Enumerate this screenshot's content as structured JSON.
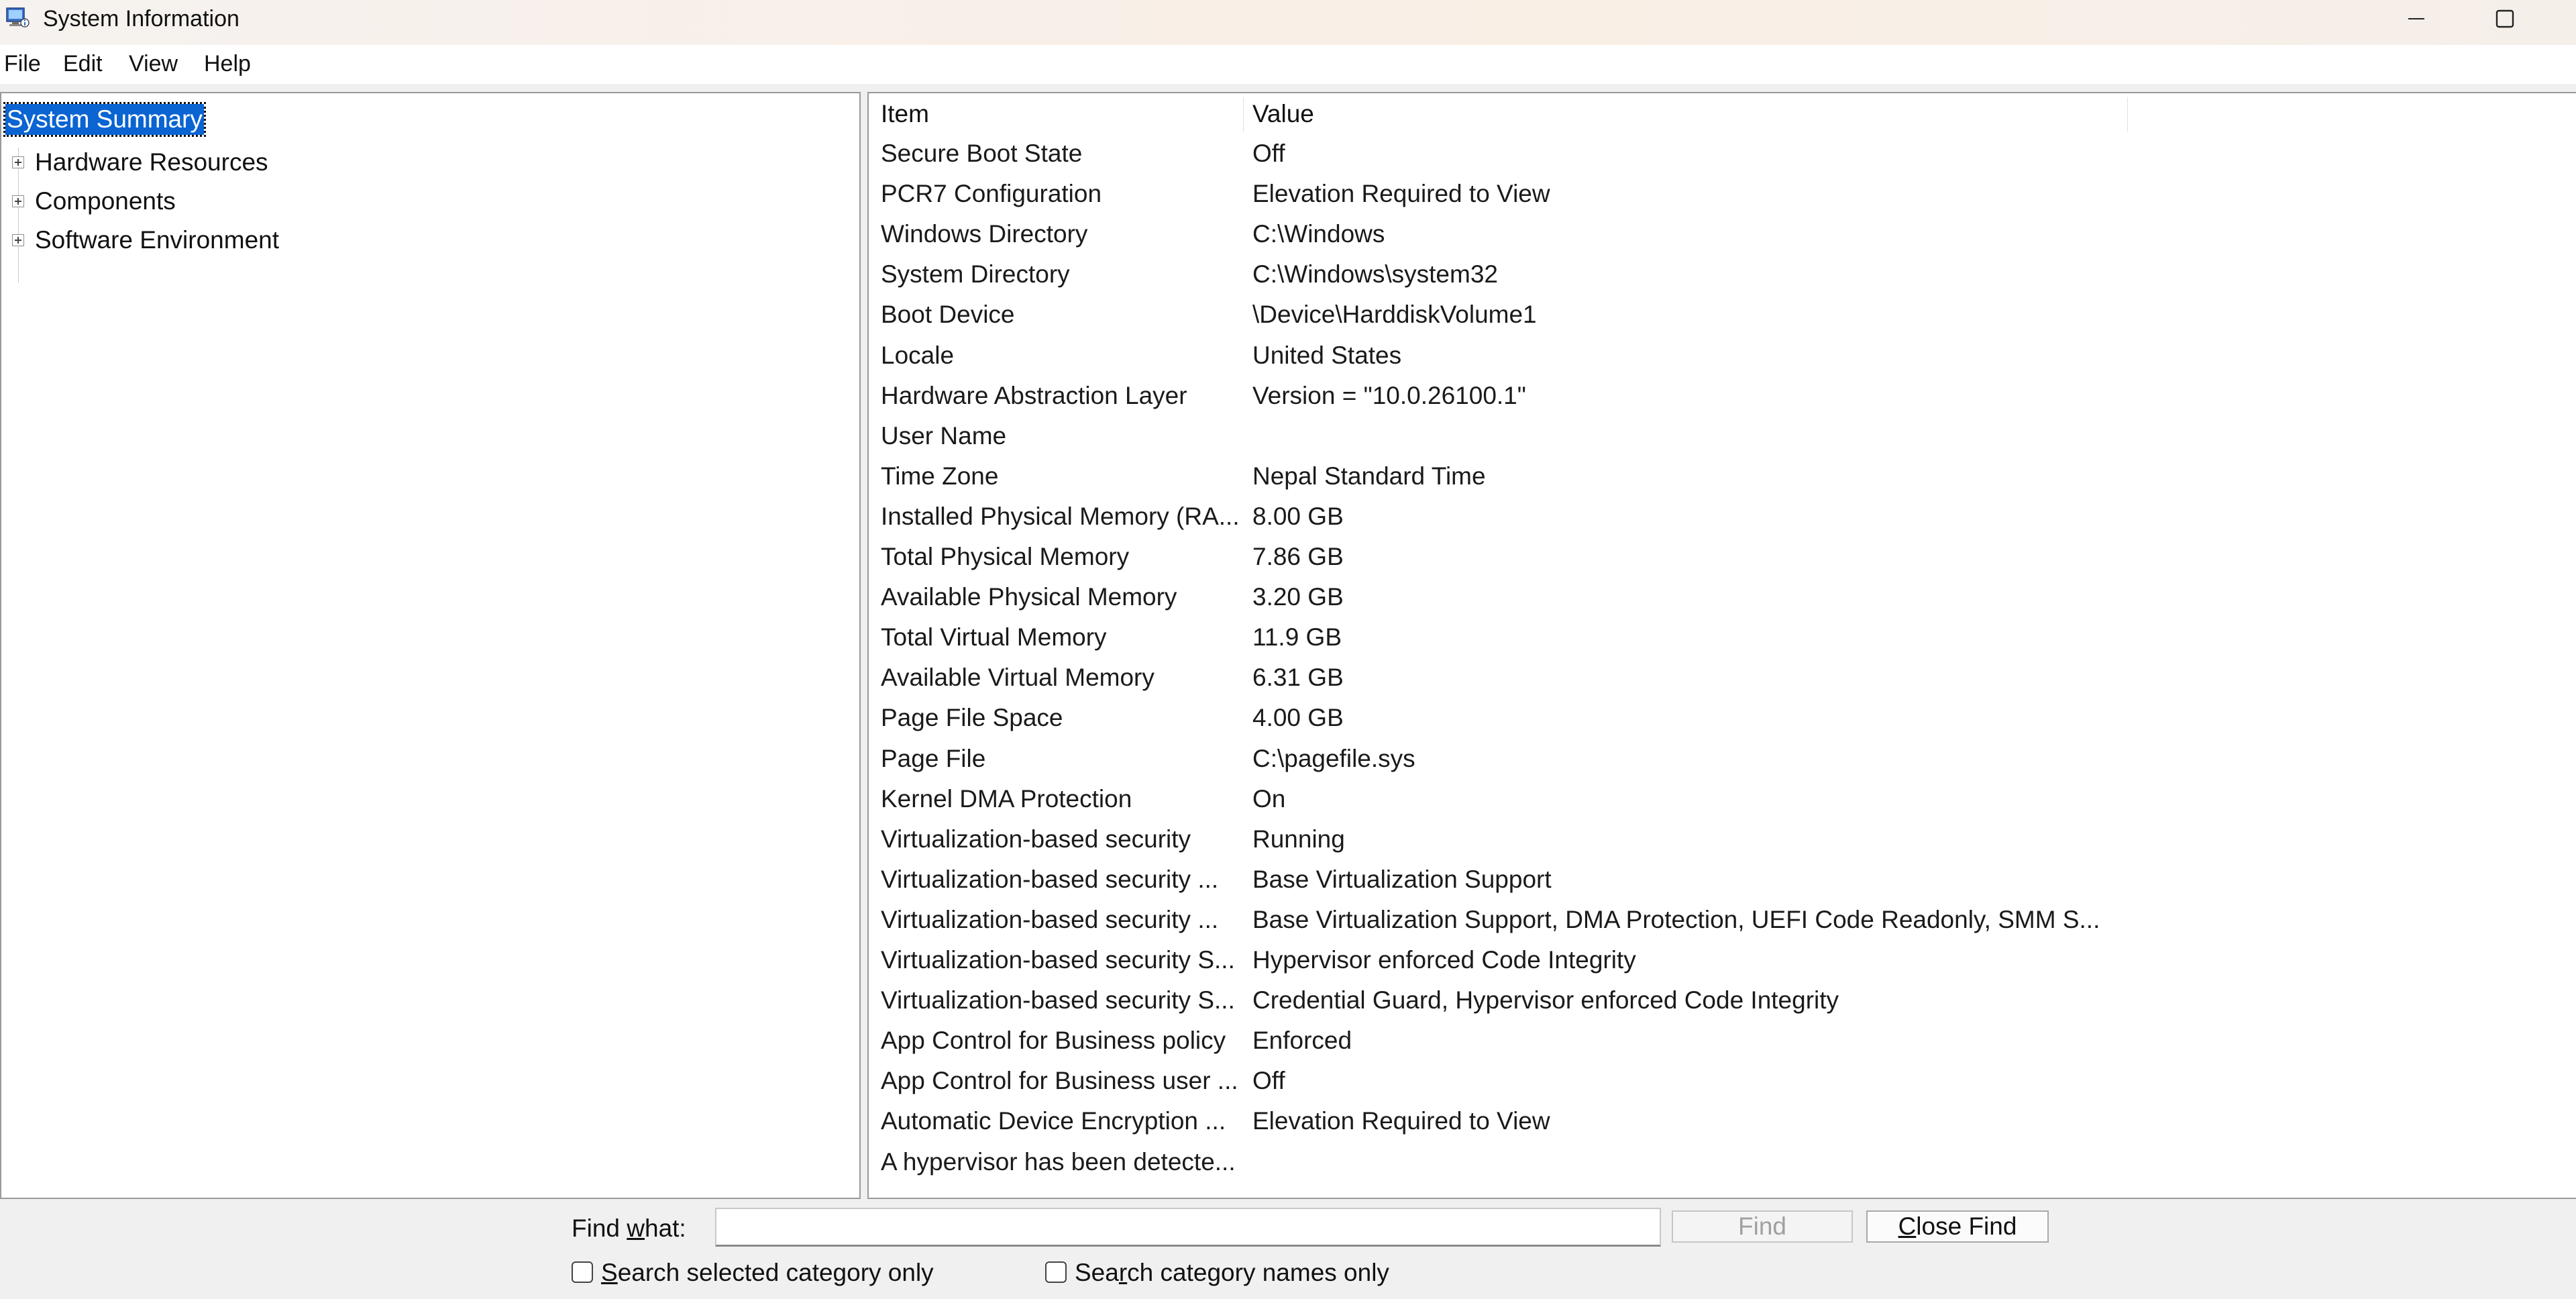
{
  "window": {
    "title": "System Information",
    "minimize_icon": "minimize-icon",
    "maximize_icon": "maximize-icon"
  },
  "menu": {
    "items": [
      "File",
      "Edit",
      "View",
      "Help"
    ]
  },
  "tree": {
    "selected": "System Summary",
    "nodes": [
      {
        "label": "System Summary",
        "expandable": false,
        "selected": true
      },
      {
        "label": "Hardware Resources",
        "expandable": true
      },
      {
        "label": "Components",
        "expandable": true
      },
      {
        "label": "Software Environment",
        "expandable": true
      }
    ]
  },
  "list": {
    "columns": [
      "Item",
      "Value"
    ],
    "rows": [
      [
        "Secure Boot State",
        "Off"
      ],
      [
        "PCR7 Configuration",
        "Elevation Required to View"
      ],
      [
        "Windows Directory",
        "C:\\Windows"
      ],
      [
        "System Directory",
        "C:\\Windows\\system32"
      ],
      [
        "Boot Device",
        "\\Device\\HarddiskVolume1"
      ],
      [
        "Locale",
        "United States"
      ],
      [
        "Hardware Abstraction Layer",
        "Version = \"10.0.26100.1\""
      ],
      [
        "User Name",
        ""
      ],
      [
        "Time Zone",
        "Nepal Standard Time"
      ],
      [
        "Installed Physical Memory (RA...",
        "8.00 GB"
      ],
      [
        "Total Physical Memory",
        "7.86 GB"
      ],
      [
        "Available Physical Memory",
        "3.20 GB"
      ],
      [
        "Total Virtual Memory",
        "11.9 GB"
      ],
      [
        "Available Virtual Memory",
        "6.31 GB"
      ],
      [
        "Page File Space",
        "4.00 GB"
      ],
      [
        "Page File",
        "C:\\pagefile.sys"
      ],
      [
        "Kernel DMA Protection",
        "On"
      ],
      [
        "Virtualization-based security",
        "Running"
      ],
      [
        "Virtualization-based security ...",
        "Base Virtualization Support"
      ],
      [
        "Virtualization-based security ...",
        "Base Virtualization Support, DMA Protection, UEFI Code Readonly, SMM S..."
      ],
      [
        "Virtualization-based security S...",
        "Hypervisor enforced Code Integrity"
      ],
      [
        "Virtualization-based security S...",
        "Credential Guard, Hypervisor enforced Code Integrity"
      ],
      [
        "App Control for Business policy",
        "Enforced"
      ],
      [
        "App Control for Business user ...",
        "Off"
      ],
      [
        "Automatic Device Encryption ...",
        "Elevation Required to View"
      ],
      [
        "A hypervisor has been detecte...",
        ""
      ]
    ]
  },
  "find": {
    "label_prefix": "Find ",
    "label_accel": "w",
    "label_suffix": "hat:",
    "value": "",
    "find_button": "Find",
    "close_prefix": "",
    "close_accel": "C",
    "close_suffix": "lose Find",
    "chk1_prefix": "",
    "chk1_accel": "S",
    "chk1_suffix": "earch selected category only",
    "chk2_prefix": "Sea",
    "chk2_accel": "r",
    "chk2_suffix": "ch category names only",
    "chk1_checked": false,
    "chk2_checked": false
  }
}
